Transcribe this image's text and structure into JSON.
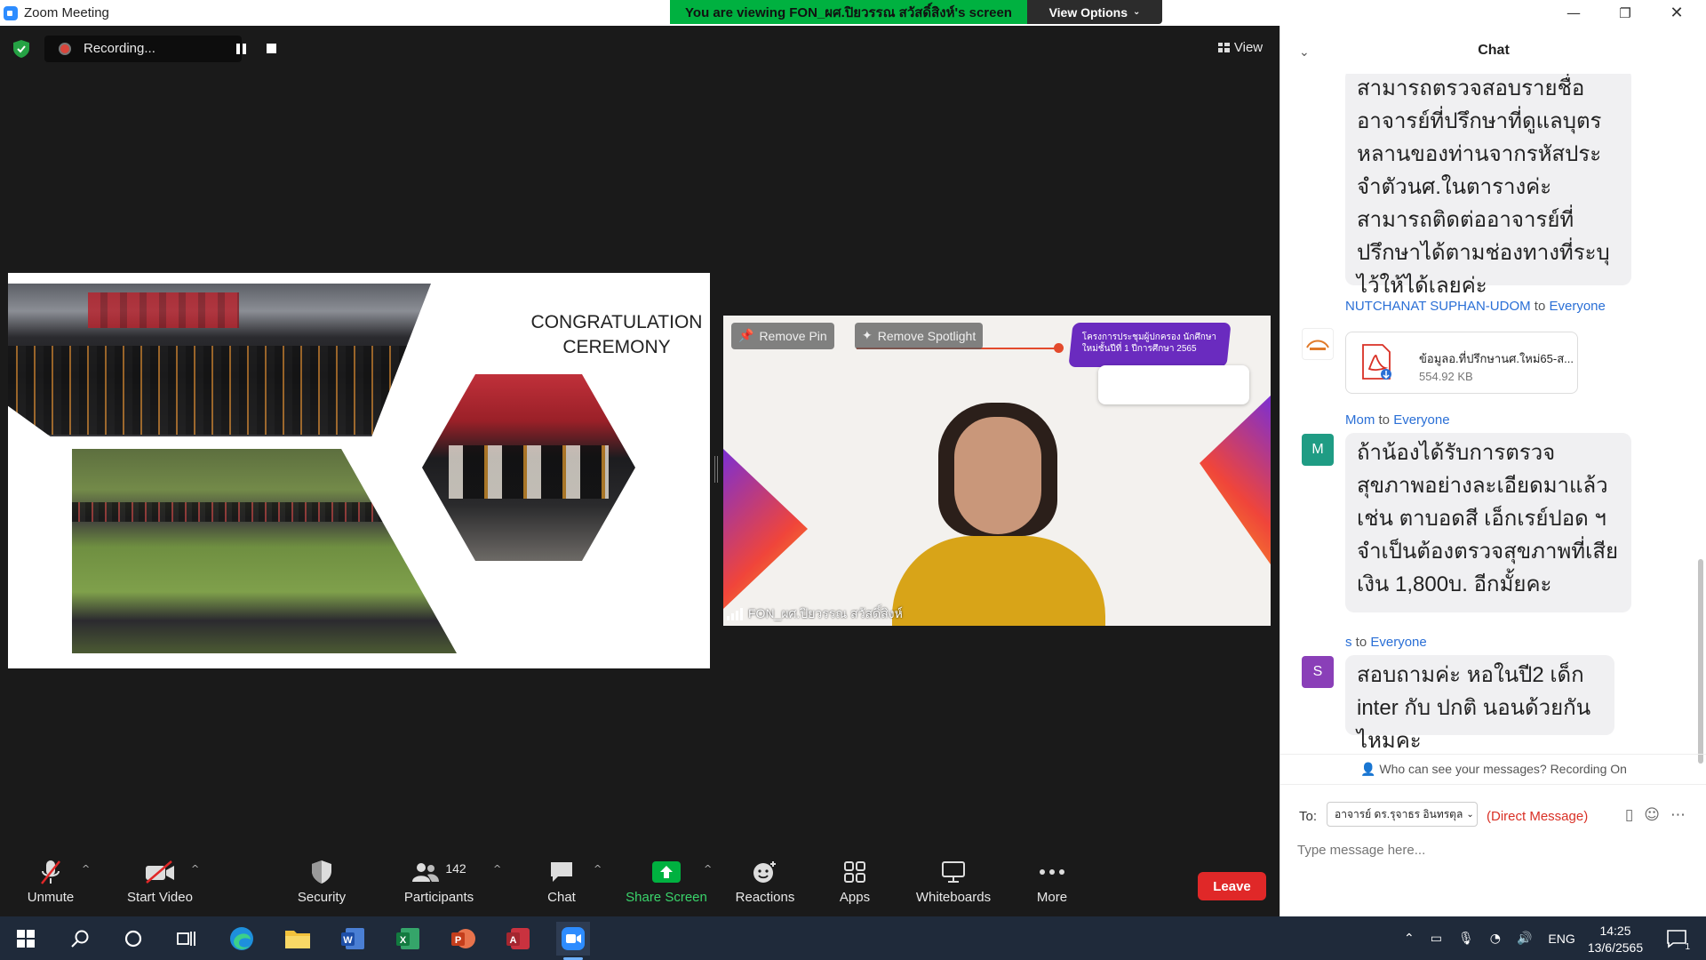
{
  "window": {
    "title": "Zoom Meeting",
    "viewing_banner": "You are viewing FON_ผศ.ปิยวรรณ สวัสดิ์สิงห์'s screen",
    "view_options": "View Options",
    "min_icon": "minimize-icon",
    "max_icon": "restore-icon",
    "close_icon": "close-icon"
  },
  "meeting": {
    "recording_label": "Recording...",
    "view_label": "View",
    "slide_title": "CONGRATULATION CEREMONY",
    "tile": {
      "remove_pin": "Remove Pin",
      "remove_spotlight": "Remove Spotlight",
      "participant_name": "FON_ผศ.ปิยวรรณ สวัสดิ์สิงห์",
      "banner_text": "โครงการประชุมผู้ปกครอง นักศึกษาใหม่ชั้นปีที่ 1 ปีการศึกษา 2565"
    }
  },
  "toolbar": {
    "unmute": "Unmute",
    "start_video": "Start Video",
    "security": "Security",
    "participants": "Participants",
    "participants_count": "142",
    "chat": "Chat",
    "share_screen": "Share Screen",
    "reactions": "Reactions",
    "apps": "Apps",
    "whiteboards": "Whiteboards",
    "more": "More",
    "leave": "Leave"
  },
  "chat": {
    "title": "Chat",
    "messages": [
      {
        "text": "สามารถตรวจสอบรายชื่ออาจารย์ที่ปรึกษาที่ดูแลบุตรหลานของท่านจากรหัสประจำตัวนศ.ในตารางค่ะ สามารถติดต่ออาจารย์ที่ปรึกษาได้ตามช่องทางที่ระบุไว้ให้ได้เลยค่ะ"
      },
      {
        "sender": "NUTCHANAT SUPHAN-UDOM",
        "to_word": "to",
        "recipient": "Everyone",
        "file_name": "ข้อมูลอ.ที่ปรึกษานศ.ใหม่65-ส...",
        "file_size": "554.92 KB"
      },
      {
        "sender": "Mom",
        "to_word": "to",
        "recipient": "Everyone",
        "avatar": "M",
        "avatar_color": "#1f9c84",
        "text": "ถ้าน้องได้รับการตรวจสุขภาพอย่างละเอียดมาแล้ว เช่น ตาบอดสี เอ็กเรย์ปอด ฯ จำเป็นต้องตรวจสุขภาพที่เสียเงิน 1,800บ. อีกมั้ยคะ"
      },
      {
        "sender": "s",
        "to_word": "to",
        "recipient": "Everyone",
        "avatar": "S",
        "avatar_color": "#8a3fb8",
        "text": "สอบถามค่ะ หอในปี2 เด็ก inter กับ ปกติ นอนด้วยกันไหมคะ"
      }
    ],
    "who_can_see": "Who can see your messages? Recording On",
    "to_label": "To:",
    "to_recipient": "อาจารย์ ดร.รุจาธร อินทรตุล",
    "direct_message": "(Direct Message)",
    "input_placeholder": "Type message here..."
  },
  "taskbar": {
    "language": "ENG",
    "time": "14:25",
    "date": "13/6/2565",
    "notification_count": "1"
  },
  "colors": {
    "accent_blue": "#2d8cff",
    "share_green": "#00b140",
    "leave_red": "#e02828",
    "banner_green": "#00b140"
  }
}
